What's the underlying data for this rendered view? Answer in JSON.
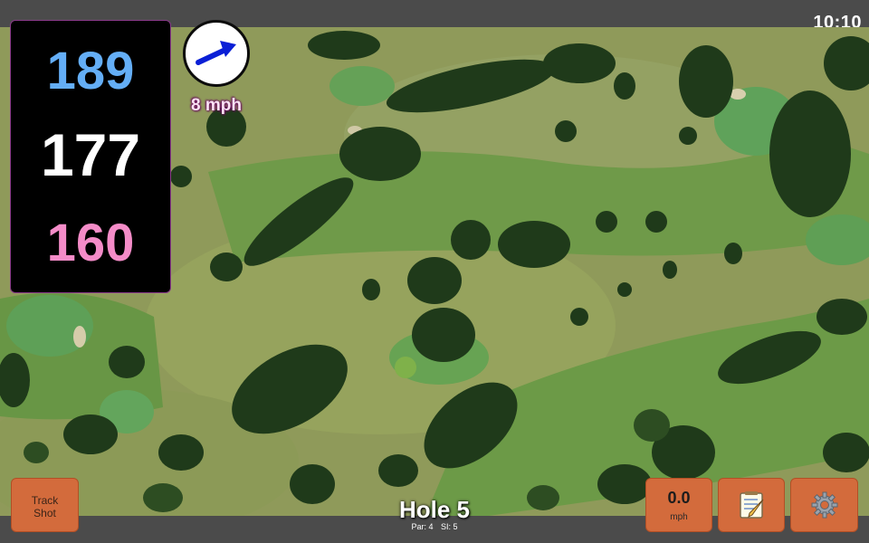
{
  "status_bar": {
    "time": "10:10"
  },
  "distances": {
    "back": "189",
    "middle": "177",
    "front": "160"
  },
  "wind": {
    "speed_text": "8 mph",
    "direction_icon": "arrow-icon"
  },
  "hole": {
    "title": "Hole 5",
    "par": "Par: 4",
    "stroke_index": "SI: 5"
  },
  "buttons": {
    "track_shot": {
      "line1": "Track",
      "line2": "Shot"
    },
    "speed": {
      "value": "0.0",
      "unit": "mph"
    },
    "notes_icon": "notepad-icon",
    "settings_icon": "gear-icon"
  },
  "colors": {
    "distance_back": "#64aef6",
    "distance_middle": "#ffffff",
    "distance_front": "#f48cc8",
    "button": "#d36b3c",
    "wind_arrow": "#0a1fd6"
  }
}
